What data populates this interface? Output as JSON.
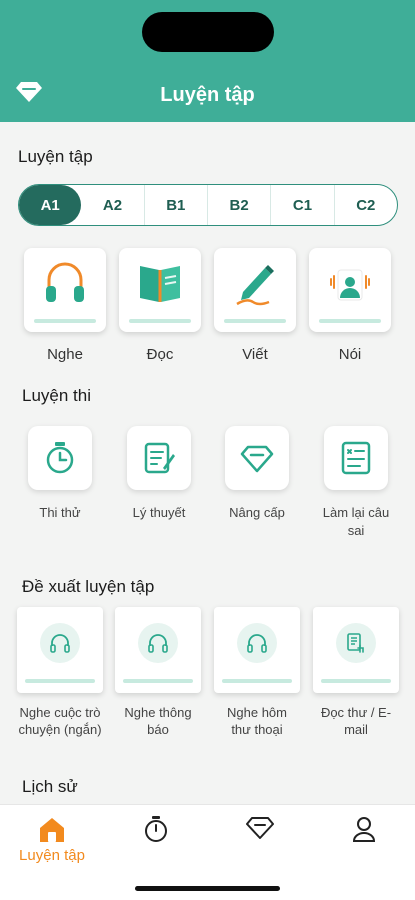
{
  "header": {
    "title": "Luyện tập",
    "icon": "diamond-icon"
  },
  "practice": {
    "title": "Luyện tập",
    "levels": [
      "A1",
      "A2",
      "B1",
      "B2",
      "C1",
      "C2"
    ],
    "active_level": "A1",
    "skills": [
      {
        "label": "Nghe",
        "icon": "headphones-icon"
      },
      {
        "label": "Đọc",
        "icon": "book-icon"
      },
      {
        "label": "Viết",
        "icon": "pen-icon"
      },
      {
        "label": "Nói",
        "icon": "speaker-person-icon"
      }
    ]
  },
  "exam": {
    "title": "Luyện thi",
    "items": [
      {
        "label": "Thi thử",
        "icon": "stopwatch-icon"
      },
      {
        "label": "Lý thuyết",
        "icon": "notes-icon"
      },
      {
        "label": "Nâng cấp",
        "icon": "diamond-icon"
      },
      {
        "label": "Làm lại câu sai",
        "icon": "checklist-icon"
      }
    ]
  },
  "suggest": {
    "title": "Đề xuất luyện tập",
    "items": [
      {
        "label": "Nghe cuộc trò chuyện (ngắn)",
        "icon": "headphones-icon"
      },
      {
        "label": "Nghe thông báo",
        "icon": "headphones-icon"
      },
      {
        "label": "Nghe hôm thư thoại",
        "icon": "headphones-icon"
      },
      {
        "label": "Đọc thư / E-mail",
        "icon": "document-touch-icon"
      }
    ]
  },
  "history": {
    "title": "Lịch sử"
  },
  "tabbar": {
    "home_label": "Luyện tập",
    "active_color": "#f28a1e",
    "icons": [
      "home-icon",
      "stopwatch-icon",
      "diamond-icon",
      "profile-icon"
    ]
  },
  "colors": {
    "brand": "#3fae98",
    "active_level_bg": "#246b5e",
    "accent": "#f28a1e"
  }
}
